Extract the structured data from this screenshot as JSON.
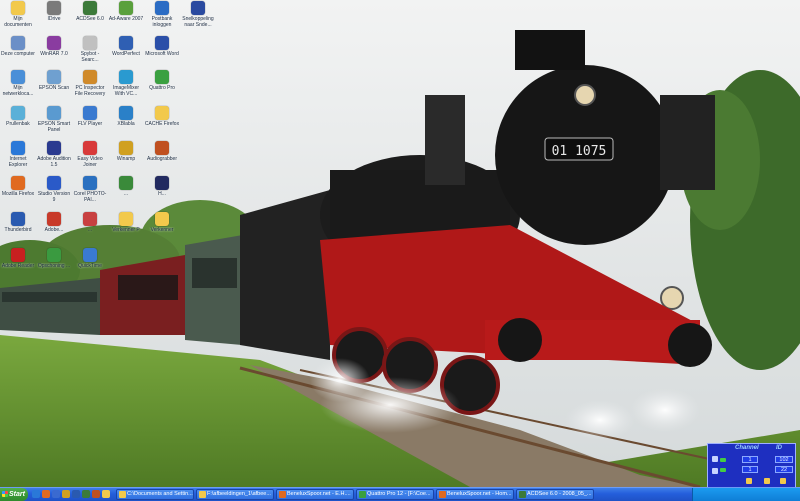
{
  "desktop": {
    "icons": [
      {
        "label": "Mijn documenten",
        "icon": "folder-icon",
        "color": "#f2c94c"
      },
      {
        "label": "IDrive",
        "icon": "drive-icon",
        "color": "#7a7a7a"
      },
      {
        "label": "ACDSee 6.0",
        "icon": "acdsee-icon",
        "color": "#3c7a3a"
      },
      {
        "label": "Ad-Aware 2007",
        "icon": "adaware-icon",
        "color": "#5aa03c"
      },
      {
        "label": "Postbank inloggen",
        "icon": "postbank-icon",
        "color": "#2b6cc4"
      },
      {
        "label": "Snelkoppeling naar Snde...",
        "icon": "shortcut-icon",
        "color": "#2a4aa0"
      },
      {
        "label": "Deze computer",
        "icon": "computer-icon",
        "color": "#6b8fc7"
      },
      {
        "label": "WinRAR 7.0",
        "icon": "winrar-icon",
        "color": "#8a3ca0"
      },
      {
        "label": "Spybot - Searc...",
        "icon": "spybot-icon",
        "color": "#c0c0c0"
      },
      {
        "label": "WordPerfect",
        "icon": "wordperfect-icon",
        "color": "#2f5fb3"
      },
      {
        "label": "Microsoft Word",
        "icon": "word-icon",
        "color": "#2b4fa8"
      },
      {
        "label": "Mijn netwerkloca...",
        "icon": "network-icon",
        "color": "#4a8fd8"
      },
      {
        "label": "EPSON Scan",
        "icon": "scanner-icon",
        "color": "#6fa0d0"
      },
      {
        "label": "PC Inspector File Recovery",
        "icon": "recovery-icon",
        "color": "#d08a2a"
      },
      {
        "label": "ImageMixer With VC...",
        "icon": "imagemixer-icon",
        "color": "#2a9ad0"
      },
      {
        "label": "Quattro Pro",
        "icon": "quattro-icon",
        "color": "#3aa040"
      },
      {
        "label": "Prullenbak",
        "icon": "recycle-bin-icon",
        "color": "#5ab0d8"
      },
      {
        "label": "EPSON Smart Panel",
        "icon": "smartpanel-icon",
        "color": "#5a9ad0"
      },
      {
        "label": "FLV Player",
        "icon": "flvplayer-icon",
        "color": "#3a7ad0"
      },
      {
        "label": "XBlabla",
        "icon": "xblabla-icon",
        "color": "#2a80c8"
      },
      {
        "label": "CACHE Firefox",
        "icon": "folder-icon",
        "color": "#f2c94c"
      },
      {
        "label": "Internet Explorer",
        "icon": "ie-icon",
        "color": "#2a78d8"
      },
      {
        "label": "Adobe Audition 1.5",
        "icon": "audition-icon",
        "color": "#2a3a90"
      },
      {
        "label": "Easy Video Joiner",
        "icon": "videojoiner-icon",
        "color": "#d83a3a"
      },
      {
        "label": "Winamp",
        "icon": "winamp-icon",
        "color": "#d0a020"
      },
      {
        "label": "Audiograbber",
        "icon": "audiograbber-icon",
        "color": "#c05020"
      },
      {
        "label": "Mozilla Firefox",
        "icon": "firefox-icon",
        "color": "#e06a20"
      },
      {
        "label": "Studio Version 9",
        "icon": "studio-icon",
        "color": "#2a5ac8"
      },
      {
        "label": "Corel PHOTO-PAI...",
        "icon": "photopaint-icon",
        "color": "#2a70c0"
      },
      {
        "label": "...",
        "icon": "app-icon",
        "color": "#3a8a3a"
      },
      {
        "label": "H...",
        "icon": "h-app-icon",
        "color": "#222a60"
      },
      {
        "label": "Thunderbird",
        "icon": "thunderbird-icon",
        "color": "#2a5ab0"
      },
      {
        "label": "Adobe...",
        "icon": "adobe-icon",
        "color": "#c83a2a"
      },
      {
        "label": "...",
        "icon": "app-icon",
        "color": "#c84040"
      },
      {
        "label": "Verkenner P",
        "icon": "folder-icon",
        "color": "#f2c94c"
      },
      {
        "label": "Verkenner",
        "icon": "folder-icon",
        "color": "#f2c94c"
      },
      {
        "label": "Adobe Reader",
        "icon": "adobe-reader-icon",
        "color": "#c82020"
      },
      {
        "label": "Opschoning ...",
        "icon": "cleanup-icon",
        "color": "#3a9a40"
      },
      {
        "label": "QuickTime",
        "icon": "quicktime-icon",
        "color": "#3a7ad0"
      }
    ]
  },
  "wallpaper": {
    "locomotive_number": "01 1075",
    "sky_color": "#dfe4e6",
    "grass_color": "#6a9a34",
    "loco_color": "#1a1a1a",
    "frame_red": "#b01818"
  },
  "taskbar": {
    "start_label": "Start",
    "quick_launch": [
      "ie-icon",
      "firefox-icon",
      "desktop-icon",
      "winamp-icon",
      "thunderbird-icon",
      "acdsee-icon",
      "media-icon",
      "folder-icon"
    ],
    "tasks": [
      {
        "label": "C:\\Documents and Settin...",
        "icon": "folder-icon",
        "color": "#f2c94c"
      },
      {
        "label": "F:\\afbeeldingen_1\\afbee...",
        "icon": "folder-icon",
        "color": "#f2c94c"
      },
      {
        "label": "BeneluxSpoor.net - E.H....",
        "icon": "firefox-icon",
        "color": "#e06a20"
      },
      {
        "label": "Quattro Pro 12 - [F:\\Coe...",
        "icon": "quattro-icon",
        "color": "#3aa040"
      },
      {
        "label": "BeneluxSpoor.net - Hom...",
        "icon": "firefox-icon",
        "color": "#e06a20"
      },
      {
        "label": "ACDSee 6.0 - 2008_05_...",
        "icon": "acdsee-icon",
        "color": "#3c7a3a"
      }
    ]
  },
  "channel_widget": {
    "title": "Channel",
    "id_title": "ID",
    "channel_values": [
      "1",
      "1"
    ],
    "id_values": [
      "102",
      "22"
    ]
  }
}
